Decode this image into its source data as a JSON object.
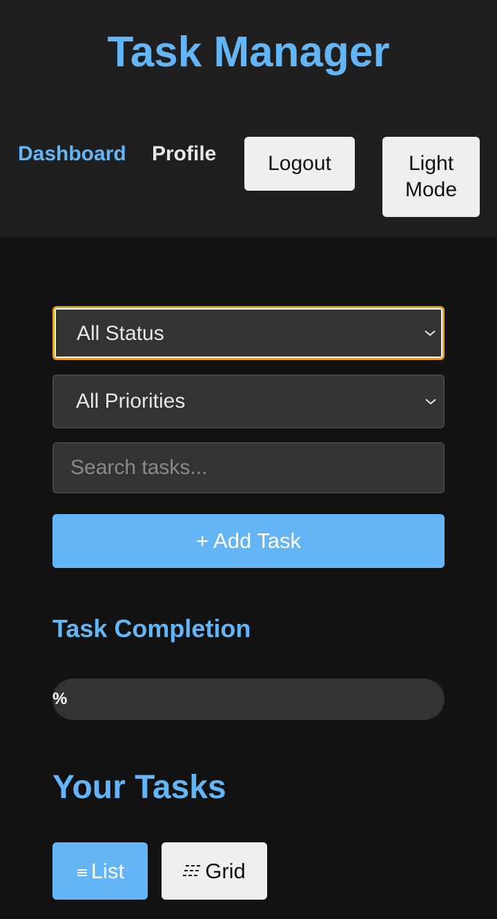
{
  "header": {
    "title": "Task Manager",
    "nav": {
      "dashboard": "Dashboard",
      "profile": "Profile"
    },
    "logout_label": "Logout",
    "theme_toggle_label": "Light Mode"
  },
  "filters": {
    "status_selected": "All Status",
    "priority_selected": "All Priorities",
    "search_placeholder": "Search tasks...",
    "search_value": ""
  },
  "actions": {
    "add_task_label": "+ Add Task"
  },
  "completion": {
    "title": "Task Completion",
    "progress_text": "%",
    "progress_percent": 0
  },
  "tasks": {
    "title": "Your Tasks",
    "view_list": {
      "icon": "list-icon",
      "label": "List"
    },
    "view_grid": {
      "icon": "grid-icon",
      "label": "Grid"
    }
  },
  "colors": {
    "accent": "#64b5f6",
    "header_bg": "#1f1f1f",
    "page_bg": "#121212",
    "field_bg": "#333333",
    "focus_ring": "#e8a317"
  }
}
